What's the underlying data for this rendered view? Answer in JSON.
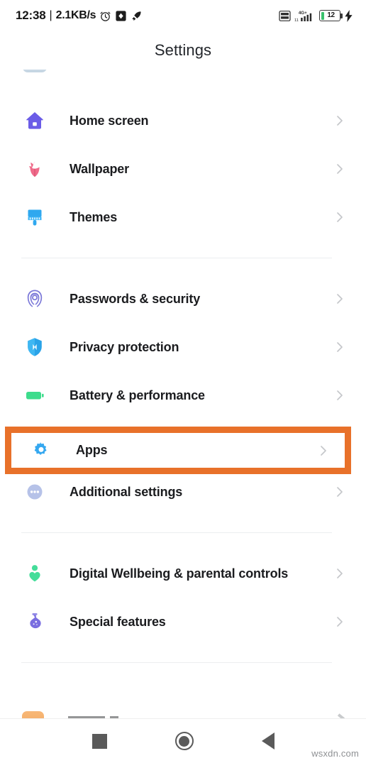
{
  "status_bar": {
    "clock": "12:38",
    "separator": "|",
    "network_speed": "2.1KB/s",
    "icons_left": [
      "alarm-clock-icon",
      "screenshot-icon",
      "rocket-icon"
    ],
    "icons_right": [
      "volte-icon",
      "signal-4gplus-icon"
    ],
    "network_label": "4G+",
    "volte_label": "VoLTE",
    "battery_percent": "12",
    "charging": true
  },
  "header": {
    "title": "Settings"
  },
  "list": {
    "groups": [
      {
        "items": [
          {
            "label": "Home screen",
            "icon": "house-icon",
            "color": "#6b5ce7"
          },
          {
            "label": "Wallpaper",
            "icon": "tulip-icon",
            "color": "#ef6b8a"
          },
          {
            "label": "Themes",
            "icon": "paintbrush-icon",
            "color": "#2fa8ef"
          }
        ]
      },
      {
        "items": [
          {
            "label": "Passwords & security",
            "icon": "fingerprint-icon",
            "color": "#7b78d8"
          },
          {
            "label": "Privacy protection",
            "icon": "shield-icon",
            "color": "#2aa3e8"
          },
          {
            "label": "Battery & performance",
            "icon": "battery-icon",
            "color": "#3ddc8c"
          },
          {
            "label": "Apps",
            "icon": "gear-icon",
            "color": "#35a8f0",
            "highlighted": true
          },
          {
            "label": "Additional settings",
            "icon": "more-dots-icon",
            "color": "#b6c2e8"
          }
        ]
      },
      {
        "items": [
          {
            "label": "Digital Wellbeing & parental controls",
            "icon": "wellbeing-person-icon",
            "color": "#44dd9a"
          },
          {
            "label": "Special features",
            "icon": "flask-icon",
            "color": "#7a6ee0"
          }
        ]
      }
    ],
    "chevron_icon": "chevron-right-icon",
    "partial_top_item": "cut-off-list-item",
    "partial_bottom_item": "cut-off-list-item"
  },
  "annotation": {
    "highlight_target": "Apps",
    "highlight_color": "#e8712a"
  },
  "nav_bar": {
    "buttons": [
      {
        "name": "recents-button",
        "icon": "square-icon"
      },
      {
        "name": "home-button",
        "icon": "circle-icon"
      },
      {
        "name": "back-button",
        "icon": "triangle-left-icon"
      }
    ]
  },
  "watermark": {
    "text": "wsxdn.com"
  }
}
